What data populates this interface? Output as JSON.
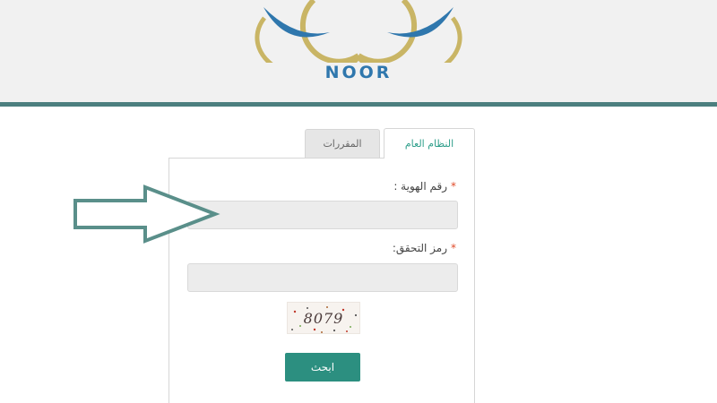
{
  "header": {
    "logo_text": "NOOR",
    "colors": {
      "logo_blue": "#2f77ad",
      "logo_gold": "#c9b565",
      "rule": "#4c7f7f"
    }
  },
  "tabs": [
    {
      "label": "النظام العام",
      "active": true
    },
    {
      "label": "المقررات",
      "active": false
    }
  ],
  "form": {
    "id_label": "رقم الهوية :",
    "id_value": "",
    "captcha_label": "رمز التحقق:",
    "captcha_value": "",
    "required_mark": "*",
    "captcha_text": "8079",
    "submit_label": "ابحث"
  },
  "annotations": {
    "arrow_icon": "right-arrow-outline-icon",
    "arrow_color": "#5a8f8a"
  }
}
